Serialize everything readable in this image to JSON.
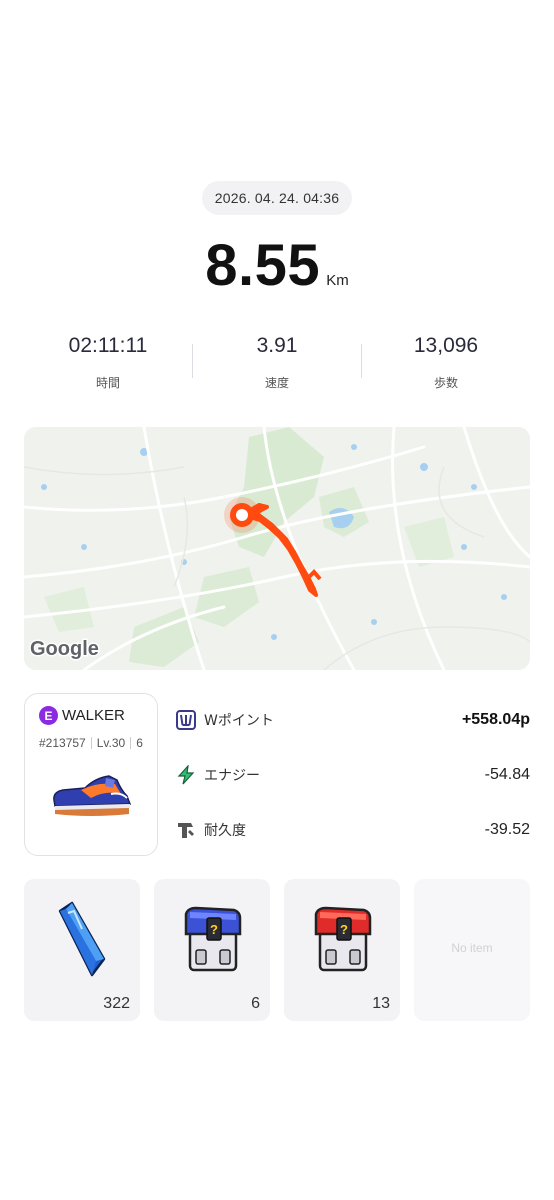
{
  "activity": {
    "datetime": "2026. 04. 24. 04:36",
    "distance_value": "8.55",
    "distance_unit": "Km"
  },
  "stats": [
    {
      "value": "02:11:11",
      "label": "時間"
    },
    {
      "value": "3.91",
      "label": "速度"
    },
    {
      "value": "13,096",
      "label": "歩数"
    }
  ],
  "map": {
    "attribution": "Google",
    "route_color": "#ff4a10"
  },
  "walker": {
    "badge": "E",
    "title": "WALKER",
    "id": "#213757",
    "level": "Lv.30",
    "extra": "6"
  },
  "results": [
    {
      "name": "Wポイント",
      "value": "+558.04p",
      "icon": "w-point-icon"
    },
    {
      "name": "エナジー",
      "value": "-54.84",
      "icon": "energy-bolt-icon"
    },
    {
      "name": "耐久度",
      "value": "-39.52",
      "icon": "durability-icon"
    }
  ],
  "items": [
    {
      "name": "gem",
      "count": "322"
    },
    {
      "name": "blue-box",
      "count": "6"
    },
    {
      "name": "red-box",
      "count": "13"
    },
    {
      "name": "empty",
      "label": "No item"
    }
  ],
  "colors": {
    "accent_purple": "#8a2be2",
    "route_orange": "#ff4a10",
    "energy_green": "#2fbf71"
  }
}
